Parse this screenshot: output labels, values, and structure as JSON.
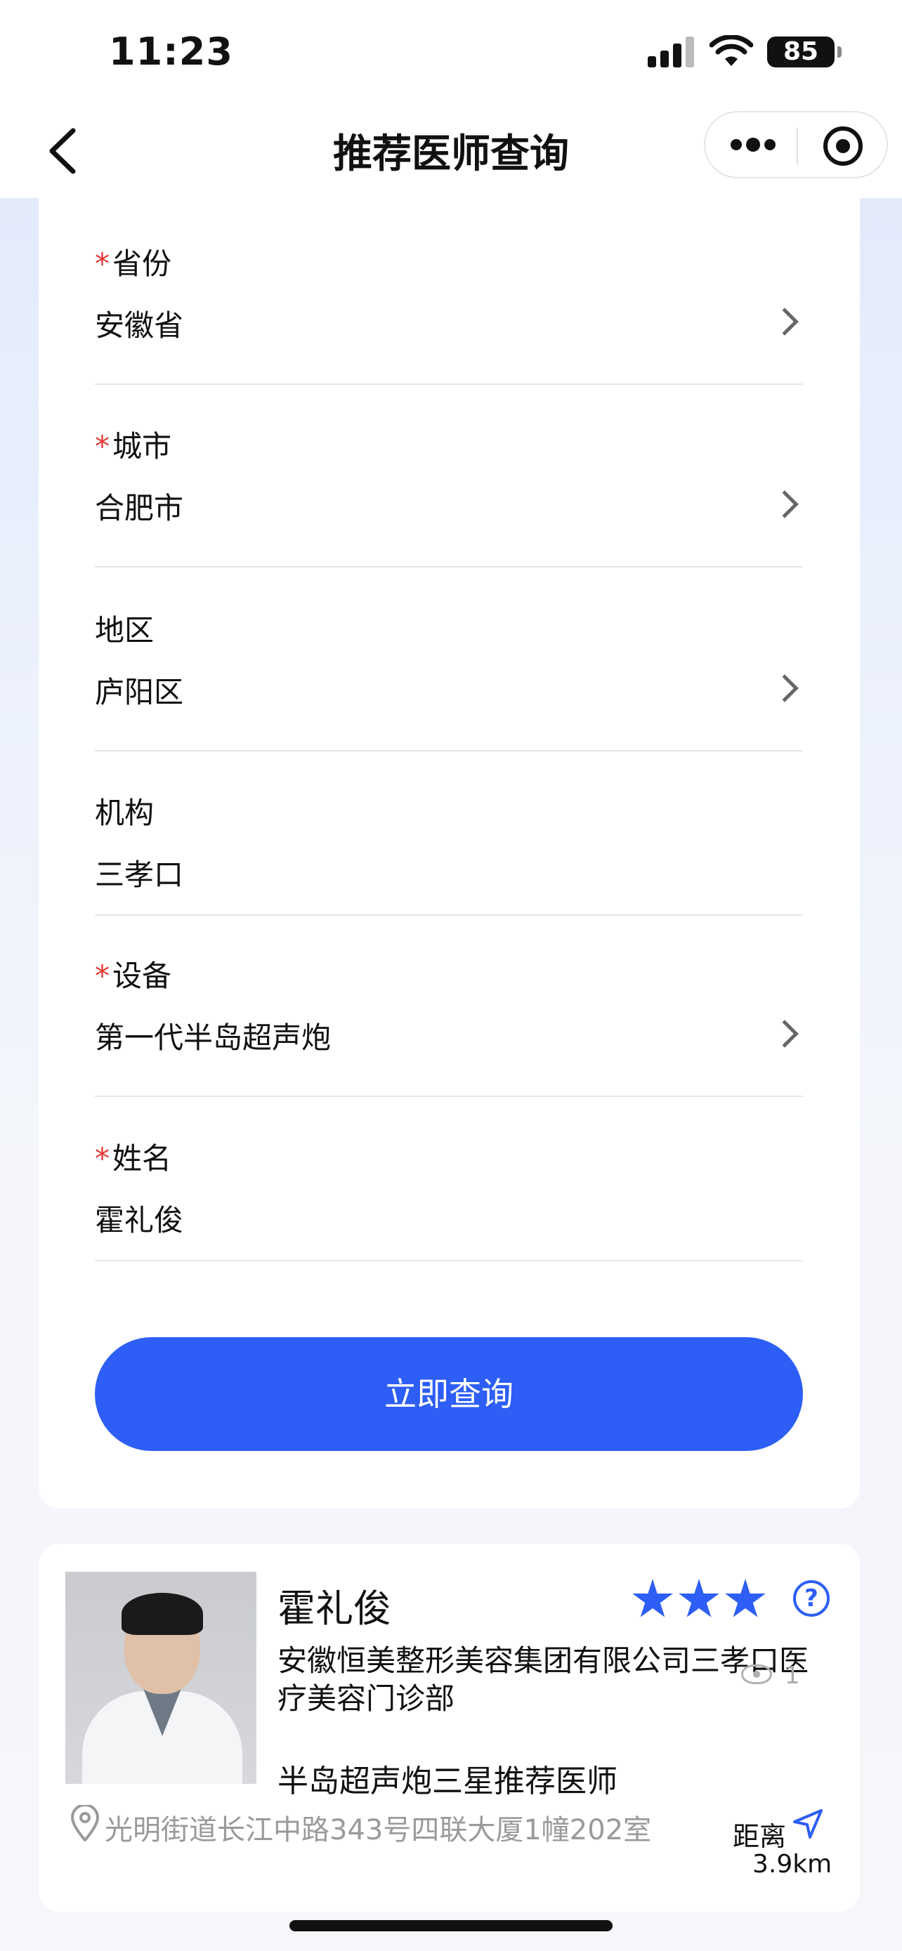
{
  "status_bar": {
    "time": "11:23",
    "battery": "85"
  },
  "nav": {
    "title": "推荐医师查询"
  },
  "form": {
    "required_mark": "*",
    "fields": [
      {
        "label": "省份",
        "value": "安徽省",
        "required": true
      },
      {
        "label": "城市",
        "value": "合肥市",
        "required": true
      },
      {
        "label": "地区",
        "value": "庐阳区",
        "required": false
      },
      {
        "label": "机构",
        "value": "三孝口",
        "required": false
      },
      {
        "label": "设备",
        "value": "第一代半岛超声炮",
        "required": true
      },
      {
        "label": "姓名",
        "value": "霍礼俊",
        "required": true
      }
    ],
    "submit_label": "立即查询"
  },
  "result": {
    "name": "霍礼俊",
    "star_count": 3,
    "help": "?",
    "organization": "安徽恒美整形美容集团有限公司三孝口医疗美容门诊部",
    "views": "1",
    "certification": "半岛超声炮三星推荐医师",
    "address": "光明街道长江中路343号四联大厦1幢202室",
    "distance_label": "距离",
    "distance_value": "3.9km"
  },
  "colors": {
    "accent": "#2d5ef5",
    "required": "#e53935"
  }
}
